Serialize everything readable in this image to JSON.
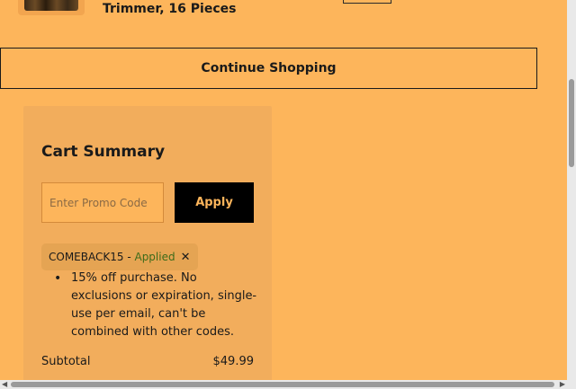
{
  "product": {
    "title": "Trimmer, 16 Pieces"
  },
  "continue_shopping_label": "Continue Shopping",
  "cart_summary": {
    "title": "Cart Summary",
    "promo_placeholder": "Enter Promo Code",
    "apply_label": "Apply",
    "applied_code": "COMEBACK15",
    "applied_separator": " - ",
    "applied_status": "Applied",
    "remove_glyph": "✕",
    "promo_description": "15% off purchase. No exclusions or expiration, single-use per email, can't be combined with other codes.",
    "subtotal_label": "Subtotal",
    "subtotal_value": "$49.99"
  },
  "colors": {
    "page_bg": "#FDB55B",
    "panel_bg": "#F2AD5C",
    "button_bg": "#000000",
    "applied_green": "#3d6b1a"
  }
}
